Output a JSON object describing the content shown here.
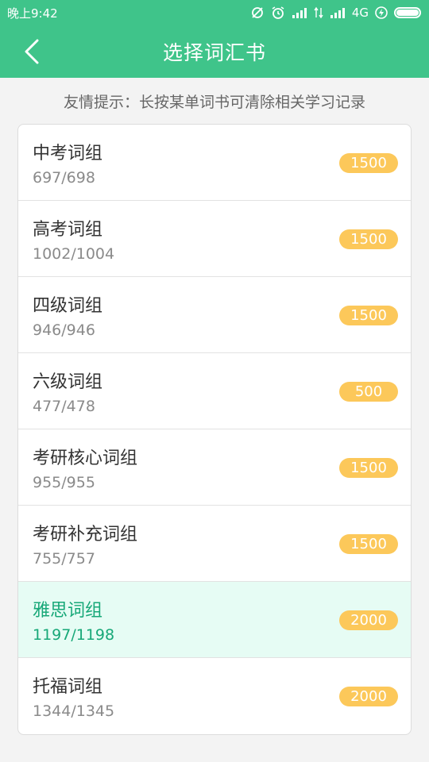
{
  "status_bar": {
    "time": "晚上9:42",
    "network": "4G"
  },
  "header": {
    "title": "选择词汇书"
  },
  "hint": "友情提示：长按某单词书可清除相关学习记录",
  "colors": {
    "primary": "#3fc48a",
    "badge": "#fcc85a",
    "selected_bg": "#e6fcf4",
    "selected_text": "#17a878"
  },
  "books": [
    {
      "name": "中考词组",
      "progress": "697/698",
      "count": "1500",
      "selected": false
    },
    {
      "name": "高考词组",
      "progress": "1002/1004",
      "count": "1500",
      "selected": false
    },
    {
      "name": "四级词组",
      "progress": "946/946",
      "count": "1500",
      "selected": false
    },
    {
      "name": "六级词组",
      "progress": "477/478",
      "count": "500",
      "selected": false
    },
    {
      "name": "考研核心词组",
      "progress": "955/955",
      "count": "1500",
      "selected": false
    },
    {
      "name": "考研补充词组",
      "progress": "755/757",
      "count": "1500",
      "selected": false
    },
    {
      "name": "雅思词组",
      "progress": "1197/1198",
      "count": "2000",
      "selected": true
    },
    {
      "name": "托福词组",
      "progress": "1344/1345",
      "count": "2000",
      "selected": false
    }
  ]
}
